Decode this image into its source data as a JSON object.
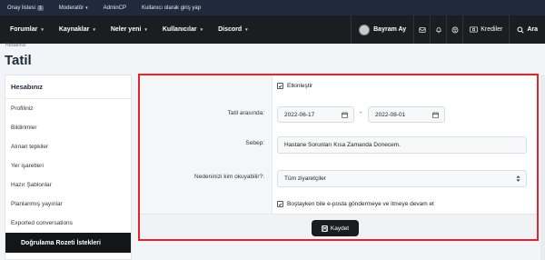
{
  "topbar": {
    "items": [
      {
        "label": "Onay listesi",
        "badge": "1"
      },
      {
        "label": "Moderatör"
      },
      {
        "label": "AdminCP"
      },
      {
        "label": "Kullanıcı olarak giriş yap"
      }
    ]
  },
  "nav": {
    "items": [
      "Forumlar",
      "Kaynaklar",
      "Neler yeni",
      "Kullanıcılar",
      "Discord"
    ],
    "user": "Bayram Ay",
    "credits": "Krediler",
    "search": "Ara"
  },
  "breadcrumb": "Hesabınız",
  "page_title": "Tatil",
  "sidebar": {
    "heading": "Hesabınız",
    "items": [
      "Profiliniz",
      "Bildirimler",
      "Alınan tepkiler",
      "Yer işaretleri",
      "Hazır Şablonlar",
      "Planlanmış yayınlar",
      "Exported conversations",
      "Doğrulama Rozeti İstekleri"
    ]
  },
  "form": {
    "enable_label": "Etkinleştir",
    "range_label": "Tatil arasında:",
    "start_date": "2022-06-17",
    "end_date": "2022-08-01",
    "date_separator": "-",
    "reason_label": "Sebep:",
    "reason_value": "Hastane Sorunları Kısa Zamanda Donecem.",
    "visibility_label": "Nedeninizi kim okuyabilir?:",
    "visibility_value": "Tüm ziyaretçiler",
    "email_option": "Boştayken bile e-posta göndermeye ve itmeye devam et",
    "save_label": "Kaydet"
  },
  "colors": {
    "topbar": "#1f2b3c",
    "navbar": "#1b1d21",
    "highlight_outline": "#e8222c",
    "button": "#1a1c20"
  }
}
